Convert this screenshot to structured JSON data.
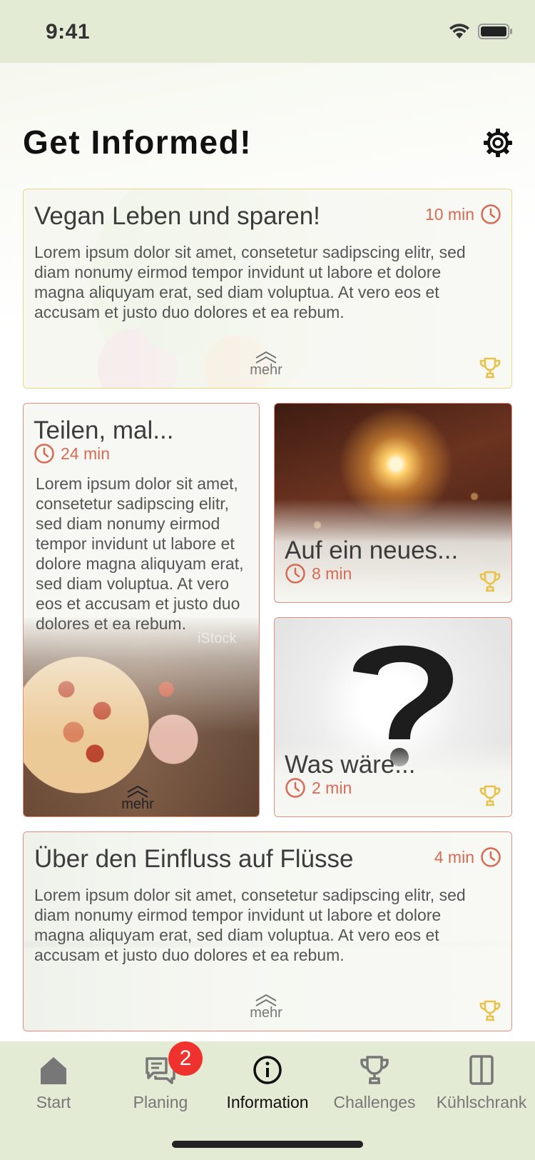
{
  "status_bar": {
    "time": "9:41"
  },
  "header": {
    "title": "Get Informed!",
    "settings_icon": "gear-icon"
  },
  "cards": [
    {
      "title": "Vegan Leben und sparen!",
      "duration": "10 min",
      "body": "Lorem ipsum dolor sit amet, consetetur sadipscing elitr, sed diam nonumy eirmod tempor invidunt ut labore et dolore magna aliquyam erat, sed diam voluptua. At vero eos et accusam et justo duo dolores et ea rebum.",
      "more": "mehr"
    },
    {
      "title": "Teilen, mal...",
      "duration": "24 min",
      "body": "Lorem ipsum dolor sit amet, consetetur sadipscing elitr, sed diam nonumy eirmod tempor invidunt ut labore et dolore magna aliquyam erat, sed diam voluptua. At vero eos et accusam et justo duo dolores et ea rebum.",
      "more": "mehr",
      "watermark": "iStock"
    },
    {
      "title": "Auf ein neues...",
      "duration": "8 min"
    },
    {
      "title": "Was wäre...",
      "duration": "2 min"
    },
    {
      "title": "Über den Einfluss auf Flüsse",
      "duration": "4 min",
      "body": "Lorem ipsum dolor sit amet, consetetur sadipscing elitr, sed diam nonumy eirmod tempor invidunt ut labore et dolore magna aliquyam erat, sed diam voluptua. At vero eos et accusam et justo duo dolores et ea rebum.",
      "more": "mehr"
    }
  ],
  "tabbar": {
    "tabs": [
      {
        "label": "Start",
        "icon": "home-icon"
      },
      {
        "label": "Planing",
        "icon": "chat-icon",
        "badge": "2"
      },
      {
        "label": "Information",
        "icon": "info-icon",
        "active": true
      },
      {
        "label": "Challenges",
        "icon": "trophy-icon"
      },
      {
        "label": "Kühlschrank",
        "icon": "fridge-icon"
      }
    ]
  },
  "colors": {
    "accent": "#d86a54",
    "trophy": "#e8c24a",
    "bar_background": "#e3ebd4",
    "badge": "#f0322e"
  }
}
